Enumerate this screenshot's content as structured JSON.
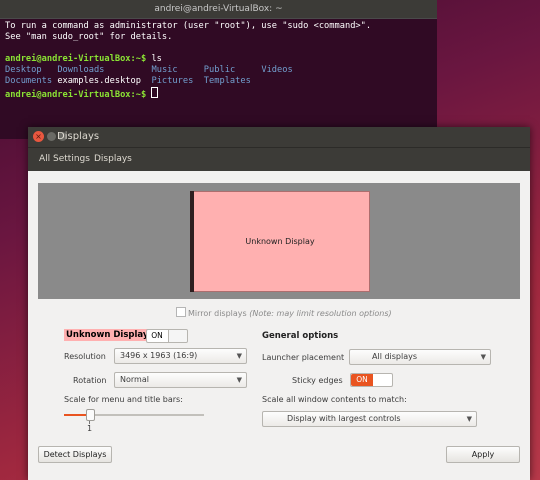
{
  "terminal": {
    "title": "andrei@andrei-VirtualBox: ~",
    "line1": "To run a command as administrator (user \"root\"), use \"sudo <command>\".",
    "line2": "See \"man sudo_root\" for details.",
    "prompt": "andrei@andrei-VirtualBox:~$",
    "command": " ls",
    "ls_row1": [
      "Desktop",
      "Downloads",
      "Music",
      "Public",
      "Videos"
    ],
    "ls_row2": [
      "Documents",
      "examples.desktop",
      "Pictures",
      "Templates"
    ],
    "prompt2": "andrei@andrei-VirtualBox:~$"
  },
  "window": {
    "title": "Displays",
    "close_glyph": "×",
    "nav": {
      "all_settings": "All Settings",
      "current": "Displays"
    }
  },
  "monitor": {
    "label": "Unknown Display"
  },
  "mirror": {
    "label": "Mirror displays",
    "note": "(Note: may limit resolution options)"
  },
  "display": {
    "name": "Unknown Display",
    "toggle": "ON",
    "resolution_label": "Resolution",
    "resolution_value": "3496 x 1963 (16:9)",
    "rotation_label": "Rotation",
    "rotation_value": "Normal",
    "scale_label": "Scale for menu and title bars:",
    "scale_value": "1",
    "scale_level": 0.15
  },
  "general": {
    "heading": "General options",
    "launcher_label": "Launcher placement",
    "launcher_value": "All displays",
    "sticky_label": "Sticky edges",
    "sticky_value": "ON",
    "scale_all_label": "Scale all window contents to match:",
    "scale_all_value": "Display with largest controls"
  },
  "buttons": {
    "detect": "Detect Displays",
    "apply": "Apply"
  },
  "colors": {
    "accent": "#e95420",
    "terminal_bg": "#300a24",
    "monitor": "#ffb0b0"
  }
}
